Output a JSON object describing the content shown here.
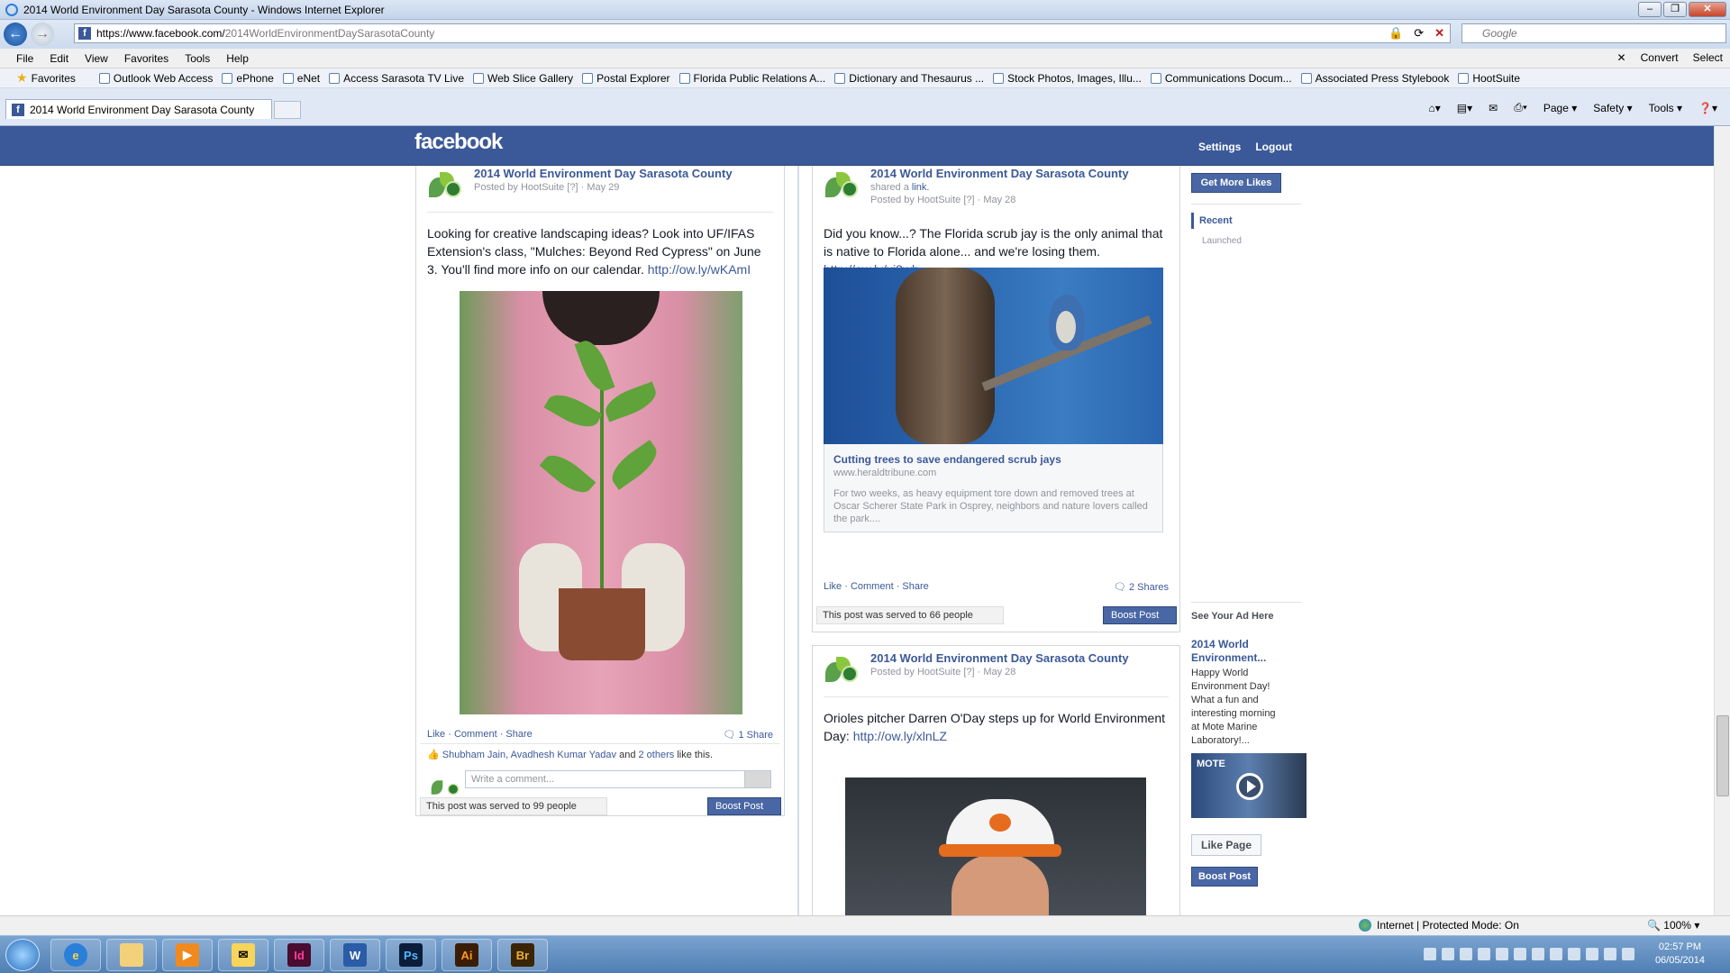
{
  "window": {
    "title": "2014 World Environment Day Sarasota County - Windows Internet Explorer"
  },
  "address_bar": {
    "url_prefix": "https://www.facebook.com/",
    "url_path": "2014WorldEnvironmentDaySarasotaCounty",
    "search_placeholder": "Google"
  },
  "menu": {
    "items": [
      "File",
      "Edit",
      "View",
      "Favorites",
      "Tools",
      "Help"
    ],
    "convert": "Convert",
    "select": "Select"
  },
  "favorites_bar": {
    "favorites_label": "Favorites",
    "items": [
      "Outlook Web Access",
      "ePhone",
      "eNet",
      "Access Sarasota TV Live",
      "Web Slice Gallery",
      "Postal Explorer",
      "Florida Public Relations A...",
      "Dictionary and Thesaurus ...",
      "Stock Photos, Images, Illu...",
      "Communications Docum...",
      "Associated Press Stylebook",
      "HootSuite"
    ]
  },
  "tab": {
    "title": "2014 World Environment Day Sarasota County"
  },
  "command_bar": {
    "page": "Page",
    "safety": "Safety",
    "tools": "Tools"
  },
  "facebook": {
    "logo": "facebook",
    "settings": "Settings",
    "logout": "Logout",
    "page_name": "2014 World Environment Day Sarasota County",
    "post1": {
      "meta": "Posted by HootSuite [?] · May 29",
      "text": "Looking for creative landscaping ideas? Look into UF/IFAS Extension's class, \"Mulches: Beyond Red Cypress\" on June 3. You'll find more info on our calendar.",
      "link": "http://ow.ly/wKAmI",
      "actions": "Like · Comment · Share",
      "shares": "1 Share",
      "likes_names": "Shubham Jain, Avadhesh Kumar Yadav",
      "likes_and": "and",
      "likes_others": "2 others",
      "likes_suffix": "like this.",
      "comment_placeholder": "Write a comment...",
      "served": "This post was served to 99 people",
      "boost": "Boost Post"
    },
    "post2": {
      "shared": "shared a",
      "shared_link": "link.",
      "meta": "Posted by HootSuite [?] · May 28",
      "text": "Did you know...? The Florida scrub jay is the only animal that is native to Florida alone... and we're losing them.",
      "link": "http://ow.ly/xi3wh",
      "attach_title": "Cutting trees to save endangered scrub jays",
      "attach_domain": "www.heraldtribune.com",
      "attach_desc": "For two weeks, as heavy equipment tore down and removed trees at Oscar Scherer State Park in Osprey, neighbors and nature lovers called the park....",
      "actions": "Like · Comment · Share",
      "shares": "2 Shares",
      "served": "This post was served to 66 people",
      "boost": "Boost Post"
    },
    "post3": {
      "meta": "Posted by HootSuite [?] · May 28",
      "text": "Orioles pitcher Darren O'Day steps up for World Environment Day:",
      "link": "http://ow.ly/xlnLZ"
    },
    "sidebar": {
      "get_more_likes": "Get More Likes",
      "recent": "Recent",
      "launched": "Launched",
      "ad_header": "See Your Ad Here",
      "ad_title": "2014 World Environment...",
      "ad_text": "Happy World Environment Day! What a fun and interesting morning at Mote Marine Laboratory!...",
      "ad_video_label": "MOTE",
      "like_page": "Like Page",
      "boost_post": "Boost Post"
    }
  },
  "status_bar": {
    "zone": "Internet | Protected Mode: On",
    "zoom": "100%"
  },
  "taskbar": {
    "apps": [
      "Id",
      "W",
      "Ps",
      "Ai",
      "Br"
    ],
    "time": "02:57 PM",
    "date": "06/05/2014"
  }
}
